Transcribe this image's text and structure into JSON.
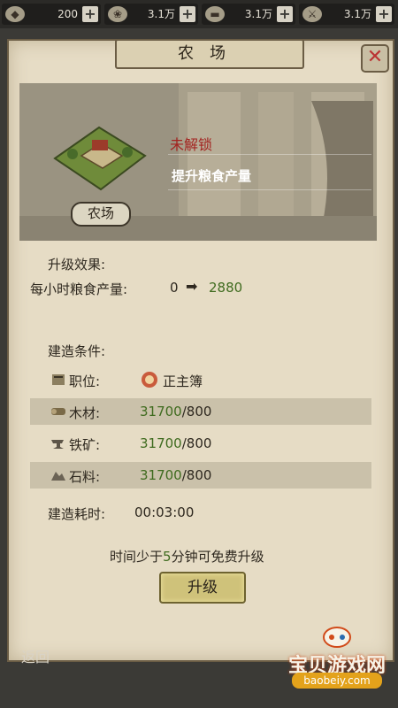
{
  "topbar": {
    "gold": "200",
    "res1": "3.1万",
    "res2": "3.1万",
    "res3": "3.1万"
  },
  "panel": {
    "title": "农场",
    "building_name": "农场",
    "status": "未解锁",
    "description": "提升粮食产量"
  },
  "effects": {
    "heading": "升级效果:",
    "label": "每小时粮食产量:",
    "from": "0",
    "to": "2880"
  },
  "conditions": {
    "heading": "建造条件:",
    "rows": [
      {
        "label": "职位:",
        "value": "正主簿"
      },
      {
        "label": "木材:",
        "have": "31700",
        "need": "/800"
      },
      {
        "label": "铁矿:",
        "have": "31700",
        "need": "/800"
      },
      {
        "label": "石料:",
        "have": "31700",
        "need": "/800"
      }
    ],
    "time_label": "建造耗时:",
    "time_value": "00:03:00"
  },
  "free_note": {
    "pre": "时间少于",
    "num": "5",
    "post": "分钟可免费升级"
  },
  "buttons": {
    "upgrade": "升级",
    "back": "返回"
  },
  "watermark": {
    "title": "宝贝游戏网",
    "url": "baobeiy.com"
  }
}
